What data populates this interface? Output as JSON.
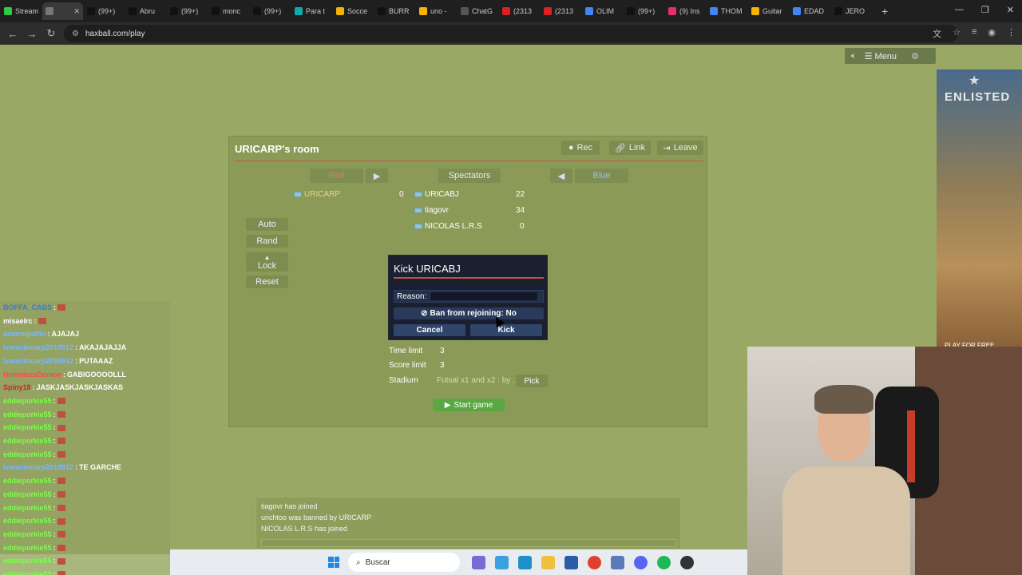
{
  "browser": {
    "tabs": [
      {
        "label": "Stream",
        "color": "#2ecc40",
        "active": false
      },
      {
        "label": "",
        "color": "#777",
        "active": true
      },
      {
        "label": "(99+)",
        "color": "#111",
        "active": false
      },
      {
        "label": "Abru",
        "color": "#111",
        "active": false
      },
      {
        "label": "(99+)",
        "color": "#111",
        "active": false
      },
      {
        "label": "monc",
        "color": "#111",
        "active": false
      },
      {
        "label": "(99+)",
        "color": "#111",
        "active": false
      },
      {
        "label": "Para t",
        "color": "#1aa",
        "active": false
      },
      {
        "label": "Socce",
        "color": "#f4b400",
        "active": false
      },
      {
        "label": "BURR",
        "color": "#111",
        "active": false
      },
      {
        "label": "uno -",
        "color": "#f4b400",
        "active": false
      },
      {
        "label": "ChatG",
        "color": "#555",
        "active": false
      },
      {
        "label": "(2313",
        "color": "#e02020",
        "active": false
      },
      {
        "label": "(2313",
        "color": "#e02020",
        "active": false
      },
      {
        "label": "OLIM",
        "color": "#4285f4",
        "active": false
      },
      {
        "label": "(99+)",
        "color": "#111",
        "active": false
      },
      {
        "label": "(9) Ins",
        "color": "#e1306c",
        "active": false
      },
      {
        "label": "THOM",
        "color": "#4285f4",
        "active": false
      },
      {
        "label": "Guitar",
        "color": "#f4b400",
        "active": false
      },
      {
        "label": "EDAD",
        "color": "#4285f4",
        "active": false
      },
      {
        "label": "JERO",
        "color": "#111",
        "active": false
      }
    ],
    "new_tab": "+",
    "url": "haxball.com/play"
  },
  "game_menu": {
    "sound_icon": "speaker-icon",
    "menu_label": "Menu",
    "settings_icon": "gear-icon"
  },
  "room": {
    "title": "URICARP's room",
    "buttons": {
      "rec": "Rec",
      "link": "Link",
      "leave": "Leave"
    },
    "teams": {
      "red": "Red",
      "spectators": "Spectators",
      "blue": "Blue"
    },
    "red_players": [
      {
        "name": "URICARP",
        "ping": "0"
      }
    ],
    "spectators": [
      {
        "name": "URICABJ",
        "ping": "22"
      },
      {
        "name": "tiagovr",
        "ping": "34"
      },
      {
        "name": "NICOLAS L.R.S",
        "ping": "0"
      }
    ],
    "side_buttons": {
      "auto": "Auto",
      "rand": "Rand",
      "lock": "Lock",
      "reset": "Reset"
    },
    "settings": {
      "time_limit_label": "Time limit",
      "time_limit_value": "3",
      "score_limit_label": "Score limit",
      "score_limit_value": "3",
      "stadium_label": "Stadium",
      "stadium_value": "Futsal x1 and x2 : by ...",
      "pick_label": "Pick"
    },
    "start_label": "Start game"
  },
  "kick_dialog": {
    "title": "Kick URICABJ",
    "reason_label": "Reason:",
    "reason_value": "",
    "ban_label": "Ban from rejoining: No",
    "cancel_label": "Cancel",
    "kick_label": "Kick"
  },
  "chat_log": [
    "tiagovr has joined",
    "urichtoo was banned by URICARP",
    "NICOLAS L.R.S has joined"
  ],
  "stream_chat": [
    {
      "user": "BOFFA_CABS",
      "user_color": "#3a7bd5",
      "text": "",
      "emote": true,
      "hl": false
    },
    {
      "user": "misaelrc",
      "user_color": "#ffffff",
      "text": "",
      "emote": true,
      "hl": false
    },
    {
      "user": "amomigatito",
      "user_color": "#7ab8ff",
      "text": "AJAJAJ",
      "emote": false,
      "hl": false
    },
    {
      "user": "ivancitocarp2018912",
      "user_color": "#7ab8ff",
      "text": "AKAJAJAJJA",
      "emote": false,
      "hl": false
    },
    {
      "user": "ivancitocarp2018912",
      "user_color": "#7ab8ff",
      "text": "PUTAAAZ",
      "emote": false,
      "hl": false
    },
    {
      "user": "HomelessDemon",
      "user_color": "#ff4a4a",
      "text": "GABIGOOOOLLL",
      "emote": false,
      "hl": false
    },
    {
      "user": "Spiny18",
      "user_color": "#cc2a2a",
      "text": "JASKJASKJASKJASKAS",
      "emote": false,
      "hl": false
    },
    {
      "user": "eddieporkie55",
      "user_color": "#7aff4a",
      "text": "",
      "emote": true,
      "hl": false
    },
    {
      "user": "eddieporkie55",
      "user_color": "#7aff4a",
      "text": "",
      "emote": true,
      "hl": false
    },
    {
      "user": "eddieporkie55",
      "user_color": "#7aff4a",
      "text": "",
      "emote": true,
      "hl": false
    },
    {
      "user": "eddieporkie55",
      "user_color": "#7aff4a",
      "text": "",
      "emote": true,
      "hl": false
    },
    {
      "user": "eddieporkie55",
      "user_color": "#7aff4a",
      "text": "",
      "emote": true,
      "hl": false
    },
    {
      "user": "ivancitocarp2018912",
      "user_color": "#7ab8ff",
      "text": "TE GARCHE",
      "emote": false,
      "hl": false
    },
    {
      "user": "eddieporkie55",
      "user_color": "#7aff4a",
      "text": "",
      "emote": true,
      "hl": false
    },
    {
      "user": "eddieporkie55",
      "user_color": "#7aff4a",
      "text": "",
      "emote": true,
      "hl": false
    },
    {
      "user": "eddieporkie55",
      "user_color": "#7aff4a",
      "text": "",
      "emote": true,
      "hl": false
    },
    {
      "user": "eddieporkie55",
      "user_color": "#7aff4a",
      "text": "",
      "emote": true,
      "hl": false
    },
    {
      "user": "eddieporkie55",
      "user_color": "#7aff4a",
      "text": "",
      "emote": true,
      "hl": false
    },
    {
      "user": "eddieporkie55",
      "user_color": "#7aff4a",
      "text": "",
      "emote": true,
      "hl": false
    },
    {
      "user": "eddieporkie55",
      "user_color": "#7aff4a",
      "text": "",
      "emote": true,
      "hl": true
    },
    {
      "user": "eddieporkie55",
      "user_color": "#7aff4a",
      "text": "",
      "emote": true,
      "hl": true
    }
  ],
  "ad": {
    "brand": "ENLISTED",
    "cta": "PLAY FOR FREE"
  },
  "taskbar": {
    "search_placeholder": "Buscar"
  }
}
